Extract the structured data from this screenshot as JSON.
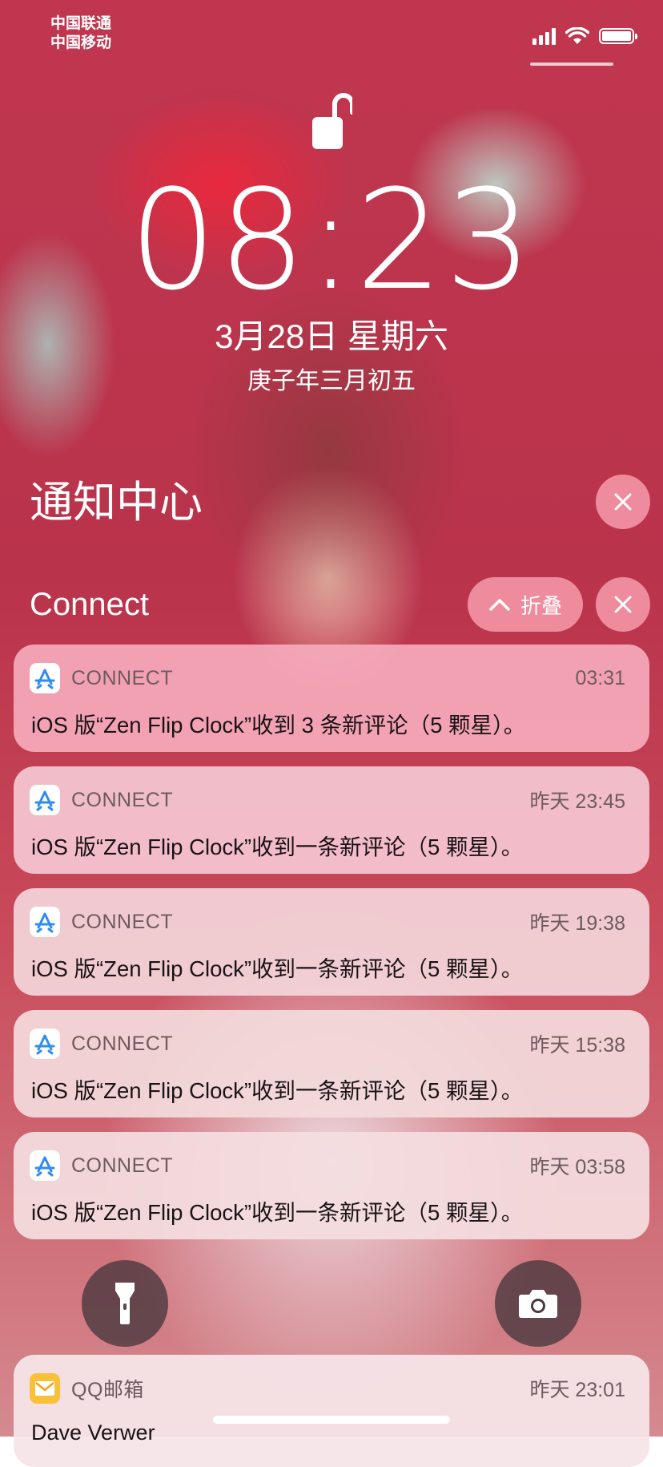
{
  "status_bar": {
    "carrier1": "中国联通",
    "carrier2": "中国移动"
  },
  "lockscreen": {
    "time": "08:23",
    "date": "3月28日 星期六",
    "lunar_date": "庚子年三月初五"
  },
  "notification_center": {
    "title": "通知中心",
    "close_icon": "close-icon"
  },
  "group": {
    "title": "Connect",
    "collapse_label": "折叠"
  },
  "notifications": [
    {
      "app": "CONNECT",
      "time": "03:31",
      "body": "iOS 版“Zen Flip Clock”收到 3 条新评论（5 颗星）。",
      "icon": "app-store-icon"
    },
    {
      "app": "CONNECT",
      "time": "昨天 23:45",
      "body": "iOS 版“Zen Flip Clock”收到一条新评论（5 颗星）。",
      "icon": "app-store-icon"
    },
    {
      "app": "CONNECT",
      "time": "昨天 19:38",
      "body": "iOS 版“Zen Flip Clock”收到一条新评论（5 颗星）。",
      "icon": "app-store-icon"
    },
    {
      "app": "CONNECT",
      "time": "昨天 15:38",
      "body": "iOS 版“Zen Flip Clock”收到一条新评论（5 颗星）。",
      "icon": "app-store-icon"
    },
    {
      "app": "CONNECT",
      "time": "昨天 03:58",
      "body": "iOS 版“Zen Flip Clock”收到一条新评论（5 颗星）。",
      "icon": "app-store-icon"
    },
    {
      "app": "QQ邮箱",
      "time": "昨天 23:01",
      "body": "Dave Verwer",
      "icon": "mail-icon"
    }
  ],
  "colors": {
    "accent_pink": "#f6aabc",
    "app_store_blue": "#2f8cf0",
    "qq_mail_yellow": "#f7c23a"
  }
}
